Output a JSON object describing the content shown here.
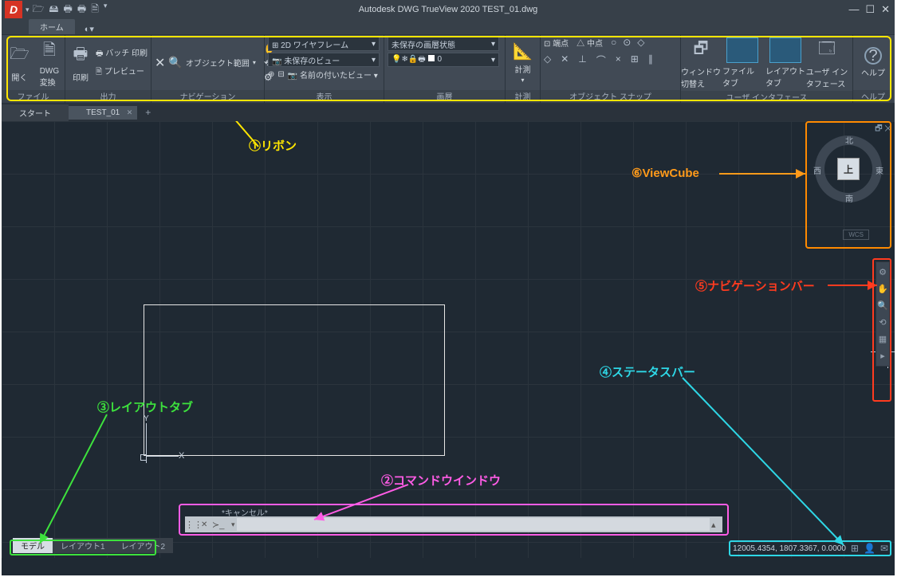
{
  "title": "Autodesk DWG TrueView 2020   TEST_01.dwg",
  "menu": {
    "home": "ホーム"
  },
  "ribbon": {
    "file": {
      "open": "開く",
      "convert": "DWG\n変換",
      "title": "ファイル"
    },
    "output": {
      "print": "印刷",
      "batch": "バッチ 印刷",
      "preview": "プレビュー",
      "title": "出力"
    },
    "nav": {
      "extents": "オブジェクト範囲",
      "title": "ナビゲーション"
    },
    "view": {
      "visual": "2D ワイヤフレーム",
      "saved": "未保存のビュー",
      "named": "名前の付いたビュー",
      "title": "表示"
    },
    "layer": {
      "state": "未保存の画層状態",
      "zero": "0",
      "title": "画層"
    },
    "measure": {
      "btn": "計測",
      "title": "計測"
    },
    "osnap": {
      "endpoint": "端点",
      "midpoint": "中点",
      "title": "オブジェクト スナップ"
    },
    "ui": {
      "switch": "ウィンドウ\n切替え",
      "filetab": "ファイル タブ",
      "layouttab": "レイアウト\nタブ",
      "userif": "ユーザ イン\nタフェース",
      "title": "ユーザ インタフェース"
    },
    "help": {
      "btn": "ヘルプ",
      "title": "ヘルプ"
    }
  },
  "filetabs": {
    "start": "スタート",
    "file1": "TEST_01"
  },
  "viewcube": {
    "top": "上",
    "n": "北",
    "s": "南",
    "e": "東",
    "w": "西",
    "wcs": "WCS"
  },
  "cmd": {
    "hist": "*キャンセル*",
    "prompt": "⌨ ▾"
  },
  "layout": {
    "model": "モデル",
    "l1": "レイアウト1",
    "l2": "レイアウト2"
  },
  "status": {
    "coords": "12005.4354, 1807.3367, 0.0000"
  },
  "anno": {
    "a1": "①リボン",
    "a2": "②コマンドウインドウ",
    "a3": "③レイアウトタブ",
    "a4": "④ステータスバー",
    "a5": "⑤ナビゲーションバー",
    "a6": "⑥ViewCube"
  }
}
